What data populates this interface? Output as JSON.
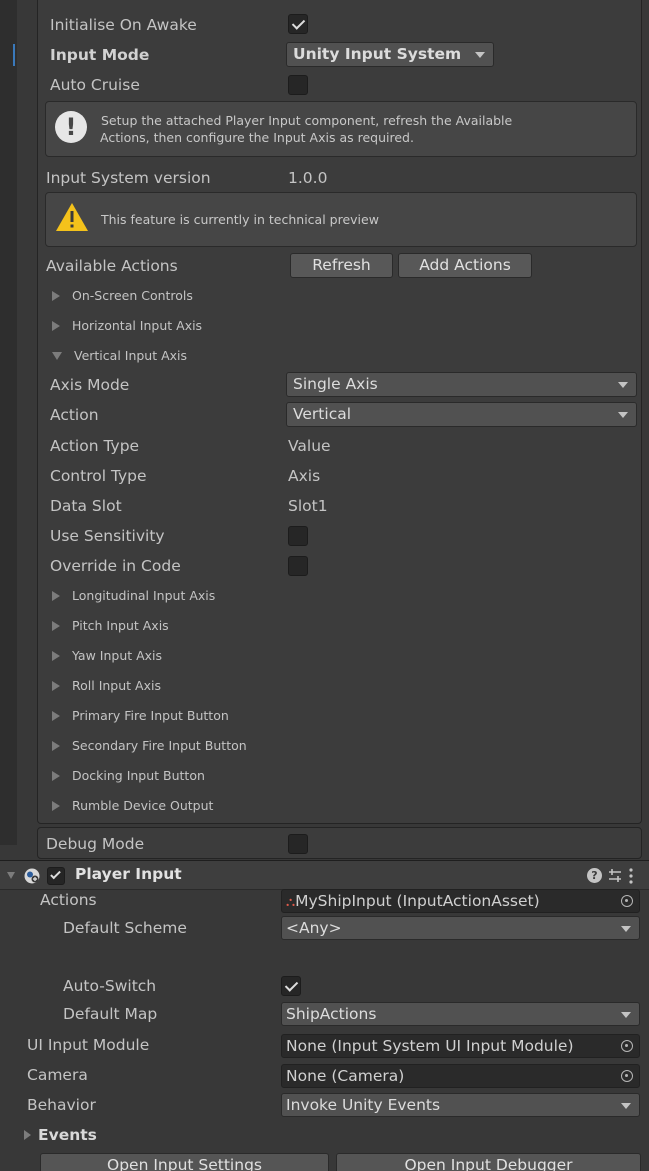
{
  "controller": {
    "initialise_label": "Initialise On Awake",
    "initialise_checked": true,
    "input_mode_label": "Input Mode",
    "input_mode_value": "Unity Input System",
    "auto_cruise_label": "Auto Cruise",
    "auto_cruise_checked": false,
    "help_line1": "Setup the attached Player Input component, refresh the Available",
    "help_line2": "Actions, then configure the Input Axis as required.",
    "version_label": "Input System version",
    "version_value": "1.0.0",
    "warning_text": "This feature is currently in technical preview",
    "available_actions_label": "Available Actions",
    "refresh_button": "Refresh",
    "add_actions_button": "Add Actions",
    "foldouts_top": [
      "On-Screen Controls",
      "Horizontal Input Axis"
    ],
    "vertical_axis_label": "Vertical Input Axis",
    "axis_mode_label": "Axis Mode",
    "axis_mode_value": "Single Axis",
    "action_label": "Action",
    "action_value": "Vertical",
    "action_type_label": "Action Type",
    "action_type_value": "Value",
    "control_type_label": "Control Type",
    "control_type_value": "Axis",
    "data_slot_label": "Data Slot",
    "data_slot_value": "Slot1",
    "use_sensitivity_label": "Use Sensitivity",
    "override_label": "Override in Code",
    "foldouts_bottom": [
      "Longitudinal Input Axis",
      "Pitch Input Axis",
      "Yaw Input Axis",
      "Roll Input Axis",
      "Primary Fire Input Button",
      "Secondary Fire Input Button",
      "Docking Input Button",
      "Rumble Device Output"
    ],
    "debug_mode_label": "Debug Mode"
  },
  "player_input": {
    "title": "Player Input",
    "enabled": true,
    "actions_label": "Actions",
    "actions_value": "MyShipInput (InputActionAsset)",
    "default_scheme_label": "Default Scheme",
    "default_scheme_value": "<Any>",
    "auto_switch_label": "Auto-Switch",
    "auto_switch_checked": true,
    "default_map_label": "Default Map",
    "default_map_value": "ShipActions",
    "ui_module_label": "UI Input Module",
    "ui_module_value": "None (Input System UI Input Module)",
    "camera_label": "Camera",
    "camera_value": "None (Camera)",
    "behavior_label": "Behavior",
    "behavior_value": "Invoke Unity Events",
    "events_label": "Events",
    "open_settings_button": "Open Input Settings",
    "open_debugger_button": "Open Input Debugger"
  },
  "icons": {
    "info": "info-exclamation-icon",
    "warning": "warning-triangle-icon",
    "help": "help-icon",
    "presets": "presets-icon",
    "menu": "kebab-menu-icon"
  }
}
